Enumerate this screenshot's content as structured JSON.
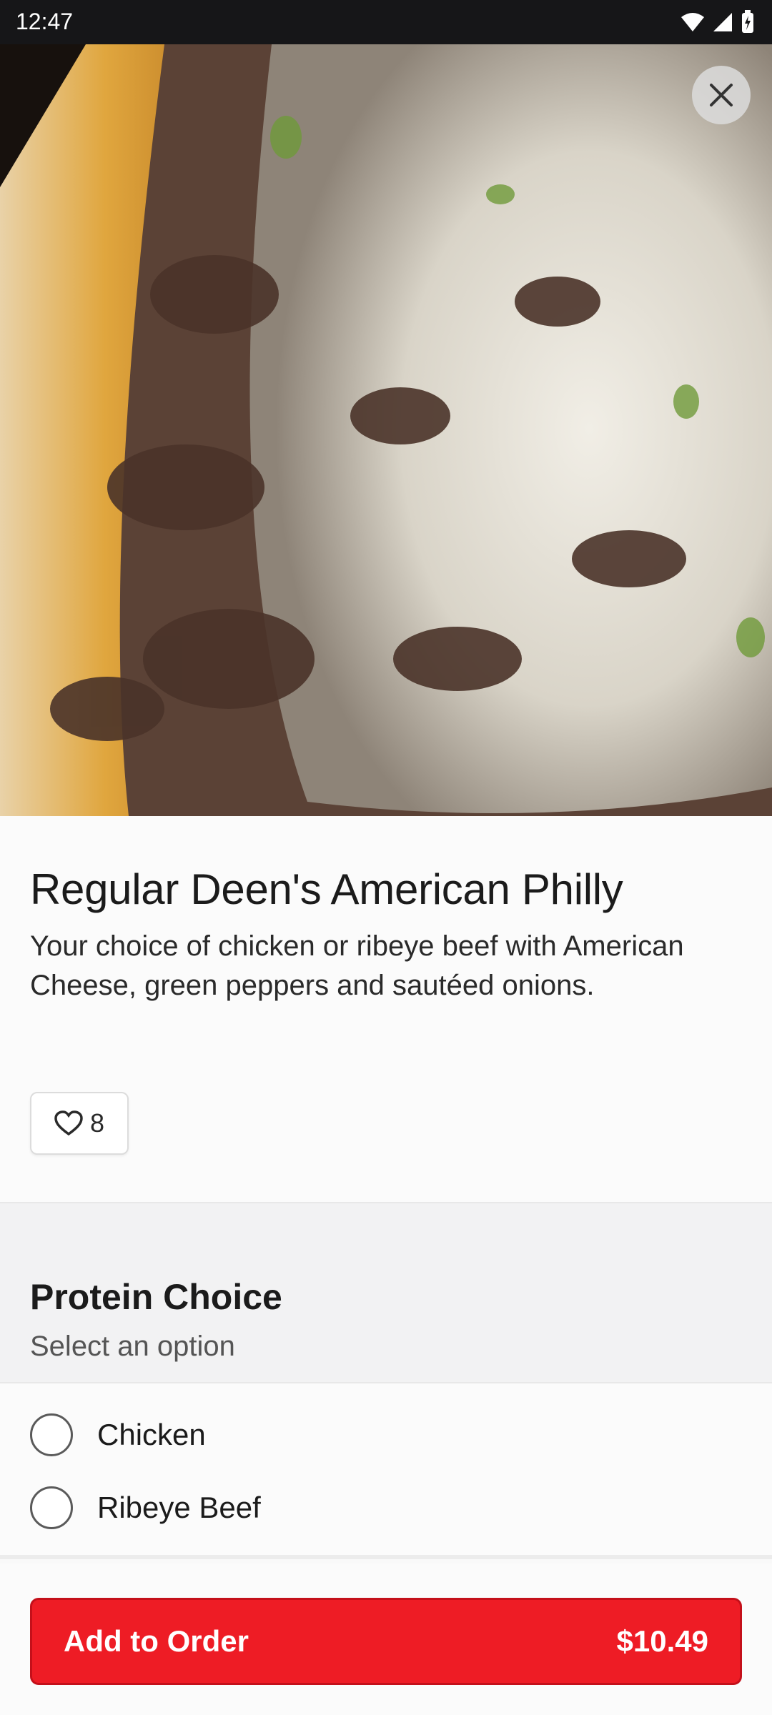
{
  "status_bar": {
    "time": "12:47"
  },
  "item": {
    "title": "Regular Deen's American Philly",
    "description": "Your choice of chicken or ribeye beef with American Cheese, green peppers and sautéed onions.",
    "favorites_count": "8"
  },
  "protein_section": {
    "heading": "Protein Choice",
    "subheading": "Select an option",
    "options": [
      {
        "label": "Chicken",
        "selected": false
      },
      {
        "label": "Ribeye Beef",
        "selected": false
      }
    ]
  },
  "footer": {
    "add_label": "Add to Order",
    "price": "$10.49"
  },
  "colors": {
    "accent": "#ee1c25",
    "status_bar": "#161618"
  },
  "icons": [
    "wifi-icon",
    "signal-icon",
    "battery-icon",
    "close-icon",
    "heart-icon"
  ]
}
